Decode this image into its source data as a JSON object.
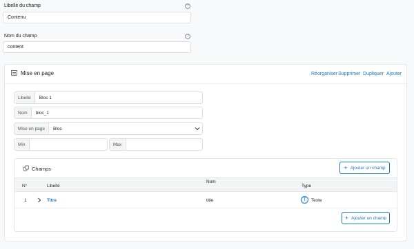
{
  "field_label": {
    "label": "Libellé du champ",
    "value": "Contenu"
  },
  "field_name": {
    "label": "Nom du champ",
    "value": "content"
  },
  "help_glyph": "?",
  "layout": {
    "title": "Mise en page",
    "actions": [
      "Réorganiser",
      "Supprimer",
      "Dupliquer",
      "Ajouter"
    ],
    "block": {
      "libelle": {
        "prefix": "Libellé",
        "value": "Bloc 1"
      },
      "nom": {
        "prefix": "Nom",
        "value": "bloc_1"
      },
      "mise_en_page": {
        "prefix": "Mise en page",
        "value": "Bloc"
      },
      "min": {
        "prefix": "Min",
        "value": ""
      },
      "max": {
        "prefix": "Max",
        "value": ""
      }
    },
    "champs": {
      "title": "Champs",
      "add_button": "Ajouter un champ",
      "headers": {
        "num": "N°",
        "libelle": "Libellé",
        "nom": "Nom",
        "type": "Type"
      },
      "rows": [
        {
          "num": "1",
          "libelle": "Titre",
          "nom": "title",
          "type": "Texte",
          "type_glyph": "T"
        }
      ]
    }
  },
  "colors": {
    "accent": "#1c77c3",
    "border": "#dcdfe4",
    "background": "#f8f9fa"
  }
}
